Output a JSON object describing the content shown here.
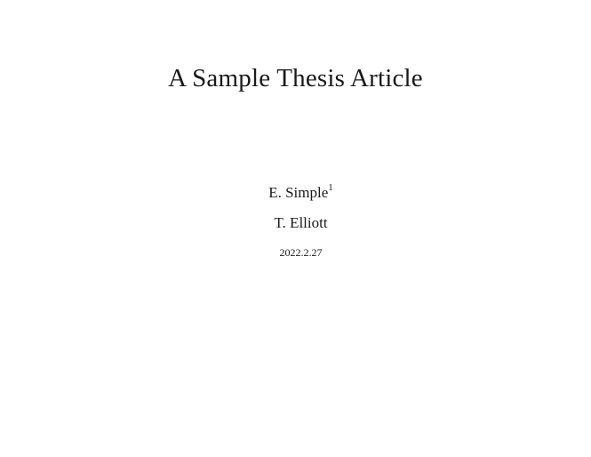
{
  "document": {
    "title": "A Sample Thesis Article",
    "authors": [
      {
        "name": "E. Simple",
        "footnote_mark": "1"
      },
      {
        "name": "T. Elliott",
        "footnote_mark": ""
      }
    ],
    "date": "2022.2.27"
  }
}
